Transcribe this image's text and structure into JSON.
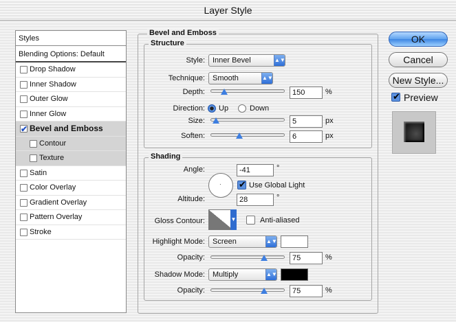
{
  "window": {
    "title": "Layer Style"
  },
  "styles_list": {
    "header": "Styles",
    "blending_options": "Blending Options: Default",
    "items": [
      {
        "label": "Drop Shadow",
        "checked": false
      },
      {
        "label": "Inner Shadow",
        "checked": false
      },
      {
        "label": "Outer Glow",
        "checked": false
      },
      {
        "label": "Inner Glow",
        "checked": false
      },
      {
        "label": "Bevel and Emboss",
        "checked": true,
        "selected": true
      },
      {
        "label": "Contour",
        "checked": false,
        "sub": true
      },
      {
        "label": "Texture",
        "checked": false,
        "sub": true
      },
      {
        "label": "Satin",
        "checked": false
      },
      {
        "label": "Color Overlay",
        "checked": false
      },
      {
        "label": "Gradient Overlay",
        "checked": false
      },
      {
        "label": "Pattern Overlay",
        "checked": false
      },
      {
        "label": "Stroke",
        "checked": false
      }
    ]
  },
  "bevel": {
    "title": "Bevel and Emboss",
    "structure": {
      "title": "Structure",
      "style_label": "Style:",
      "style_value": "Inner Bevel",
      "technique_label": "Technique:",
      "technique_value": "Smooth",
      "depth_label": "Depth:",
      "depth_value": "150",
      "depth_unit": "%",
      "depth_level": 0.15,
      "direction_label": "Direction:",
      "direction_up": "Up",
      "direction_down": "Down",
      "direction_selected": "Up",
      "size_label": "Size:",
      "size_value": "5",
      "size_unit": "px",
      "size_level": 0.02,
      "soften_label": "Soften:",
      "soften_value": "6",
      "soften_unit": "px",
      "soften_level": 0.38
    },
    "shading": {
      "title": "Shading",
      "angle_label": "Angle:",
      "angle_value": "-41",
      "angle_unit": "°",
      "use_global_light_label": "Use Global Light",
      "use_global_light": true,
      "altitude_label": "Altitude:",
      "altitude_value": "28",
      "altitude_unit": "°",
      "gloss_contour_label": "Gloss Contour:",
      "anti_aliased_label": "Anti-aliased",
      "anti_aliased": false,
      "highlight_mode_label": "Highlight Mode:",
      "highlight_mode_value": "Screen",
      "highlight_color": "#ffffff",
      "highlight_opacity_label": "Opacity:",
      "highlight_opacity_value": "75",
      "highlight_opacity_unit": "%",
      "highlight_opacity_level": 0.75,
      "shadow_mode_label": "Shadow Mode:",
      "shadow_mode_value": "Multiply",
      "shadow_color": "#000000",
      "shadow_opacity_label": "Opacity:",
      "shadow_opacity_value": "75",
      "shadow_opacity_unit": "%",
      "shadow_opacity_level": 0.75
    }
  },
  "buttons": {
    "ok": "OK",
    "cancel": "Cancel",
    "new_style": "New Style...",
    "preview_label": "Preview",
    "preview_checked": true
  },
  "colors": {
    "accent": "#3d86e3"
  }
}
